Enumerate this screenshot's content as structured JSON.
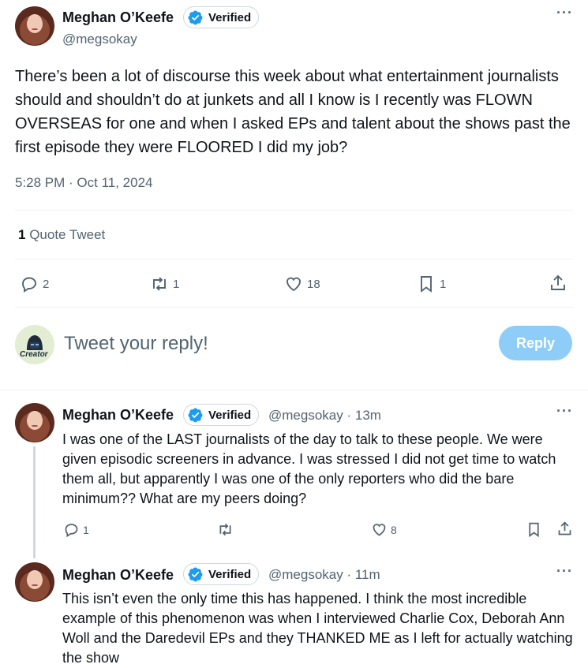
{
  "main_tweet": {
    "author_name": "Meghan O’Keefe",
    "verified_label": "Verified",
    "handle": "@megsokay",
    "text": "There’s been a lot of discourse this week about what entertainment journalists should and shouldn’t do at junkets and all I know is I recently was FLOWN OVERSEAS for one and when I asked EPs and talent about the shows past the first episode they were FLOORED I did my job?",
    "timestamp": "5:28 PM · Oct 11, 2024",
    "quote_count": "1",
    "quote_label": "Quote Tweet",
    "actions": {
      "replies": "2",
      "retweets": "1",
      "likes": "18",
      "bookmarks": "1"
    }
  },
  "reply_box": {
    "avatar_label": "Creator",
    "placeholder": "Tweet your reply!",
    "button_label": "Reply"
  },
  "replies": [
    {
      "author_name": "Meghan O’Keefe",
      "verified_label": "Verified",
      "handle": "@megsokay",
      "time": "· 13m",
      "text": "I was one of the LAST journalists of the day to talk to these people. We were given episodic screeners in advance. I was stressed I did not get time to watch them all, but apparently I was one of the only reporters who did the bare minimum?? What are my peers doing?",
      "actions": {
        "replies": "1",
        "retweets": "",
        "likes": "8"
      }
    },
    {
      "author_name": "Meghan O’Keefe",
      "verified_label": "Verified",
      "handle": "@megsokay",
      "time": "· 11m",
      "text": "This isn’t even the only time this has happened. I think the most incredible example of this phenomenon was when I interviewed Charlie Cox, Deborah Ann Woll and the Daredevil EPs and they THANKED ME as I left for actually watching the show"
    }
  ],
  "colors": {
    "accent": "#1d9bf0",
    "reply_button": "#8ecdf8",
    "muted": "#536471"
  }
}
